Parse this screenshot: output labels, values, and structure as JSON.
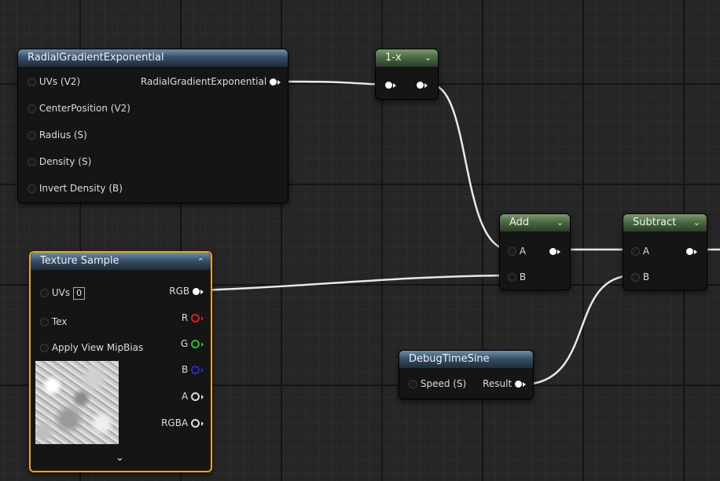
{
  "nodes": {
    "radial": {
      "title": "RadialGradientExponential",
      "inputs": [
        "UVs (V2)",
        "CenterPosition (V2)",
        "Radius (S)",
        "Density (S)",
        "Invert Density (B)"
      ],
      "output": "RadialGradientExponential"
    },
    "one_minus": {
      "title": "1-x"
    },
    "add": {
      "title": "Add",
      "inputs": [
        "A",
        "B"
      ]
    },
    "subtract": {
      "title": "Subtract",
      "inputs": [
        "A",
        "B"
      ]
    },
    "texture_sample": {
      "title": "Texture Sample",
      "inputs": [
        "UVs",
        "Tex",
        "Apply View MipBias"
      ],
      "uvs_value": "0",
      "outputs": [
        "RGB",
        "R",
        "G",
        "B",
        "A",
        "RGBA"
      ]
    },
    "debug_time_sine": {
      "title": "DebugTimeSine",
      "input": "Speed (S)",
      "output": "Result"
    }
  },
  "colors": {
    "selected_border": "#e8a41c",
    "pin_red": "#d92020",
    "pin_green": "#1fc21f",
    "pin_blue": "#2a2ad4"
  },
  "icons": {
    "collapse": "chevron-up-icon",
    "expand": "chevron-down-icon"
  }
}
